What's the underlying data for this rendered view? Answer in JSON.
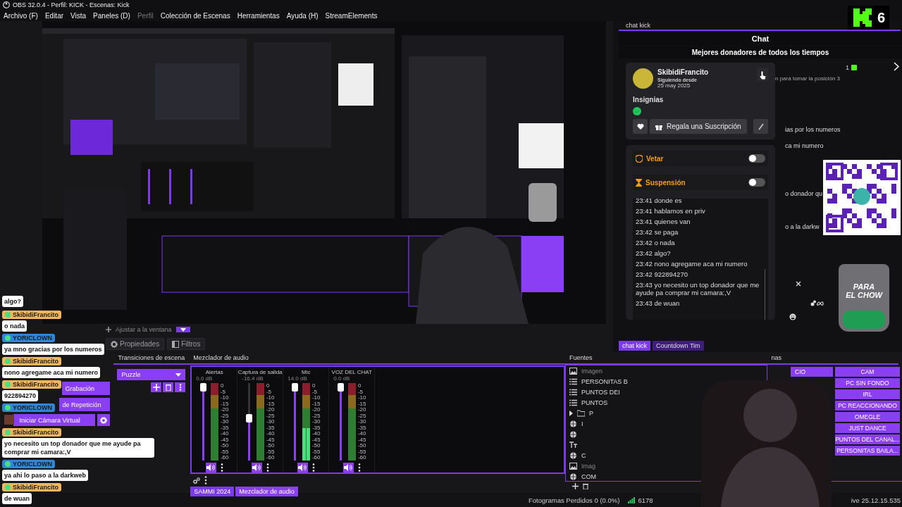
{
  "window": {
    "title": "OBS 32.0.4 - Perfil: KICK - Escenas: Kick"
  },
  "menu": [
    {
      "label": "Archivo (F)",
      "disabled": false
    },
    {
      "label": "Editar",
      "disabled": false
    },
    {
      "label": "Vista",
      "disabled": false
    },
    {
      "label": "Paneles (D)",
      "disabled": false
    },
    {
      "label": "Perfil",
      "disabled": true
    },
    {
      "label": "Colección de Escenas",
      "disabled": false
    },
    {
      "label": "Herramientas",
      "disabled": false
    },
    {
      "label": "Ayuda (H)",
      "disabled": false
    },
    {
      "label": "StreamElements",
      "disabled": false
    }
  ],
  "stream_logo": {
    "count": "6"
  },
  "preview_toolbar": {
    "fit_label": "Ajustar a la ventana"
  },
  "source_buttons": [
    {
      "label": "Propiedades",
      "kind": "properties"
    },
    {
      "label": "Filtros",
      "kind": "filters"
    }
  ],
  "chat_dock": {
    "tab": "chat kick",
    "header": "Chat",
    "subheader": "Mejores donadores de todos los tiempos",
    "user_card": {
      "username": "SkibidiFrancito",
      "following_label": "Siguiendo desde",
      "following_date": "25 may 2025",
      "badges_label": "Insignias",
      "gift_button": "Regala una Suscripción"
    },
    "moderation": [
      {
        "label": "Vetar",
        "kind": "ban",
        "on": false
      },
      {
        "label": "Suspensión",
        "kind": "timeout",
        "on": false
      }
    ],
    "log": [
      "23:41 donde es",
      "23:41 hablamos en priv",
      "23:41 quienes van",
      "23:42 se paga",
      "23:42 o nada",
      "23:42 algo?",
      "23:42 nono agregame aca mi numero",
      "23:42 922894270",
      "23:43 yo necesito un top donador que me ayude pa comprar mi camara:,V",
      "23:43 de wuan"
    ],
    "behind": {
      "rank": "1",
      "position_text": "n para tomar la posición 3",
      "fragments": [
        "ias por los numeros",
        "ca mi numero",
        "o donador qu",
        "o a la darkw"
      ]
    },
    "dock_tabs": [
      {
        "label": "chat kick",
        "selected": true
      },
      {
        "label": "Countdown Tim",
        "selected": false
      }
    ]
  },
  "jar_overlay": {
    "lines": [
      "PARA",
      "EL CHOW"
    ]
  },
  "chat_overlay": [
    {
      "kind": "message",
      "text": "algo?"
    },
    {
      "kind": "user",
      "name": "SkibidiFrancito",
      "color": "#f2b75c"
    },
    {
      "kind": "message",
      "text": "o nada"
    },
    {
      "kind": "user",
      "name": "YORICLOWN",
      "color": "#2f86d6"
    },
    {
      "kind": "message",
      "text": "ya mno gracias por los numeros"
    },
    {
      "kind": "user",
      "name": "SkibidiFrancito",
      "color": "#f2b75c"
    },
    {
      "kind": "message",
      "text": "nono agregame aca mi numero"
    },
    {
      "kind": "user",
      "name": "SkibidiFrancito",
      "color": "#f2b75c"
    },
    {
      "kind": "message",
      "text": "922894270"
    },
    {
      "kind": "user",
      "name": "YORICLOWN",
      "color": "#2f86d6"
    },
    {
      "kind": "emote"
    },
    {
      "kind": "user",
      "name": "SkibidiFrancito",
      "color": "#f2b75c"
    },
    {
      "kind": "message",
      "text": "yo necesito un top donador que me ayude pa comprar mi camara:,V"
    },
    {
      "kind": "user",
      "name": "YORICLOWN",
      "color": "#2f86d6"
    },
    {
      "kind": "message",
      "text": "ya ahi lo paso a la darkweb"
    },
    {
      "kind": "user",
      "name": "SkibidiFrancito",
      "color": "#f2b75c"
    },
    {
      "kind": "message",
      "text": "de wuan"
    }
  ],
  "controls": [
    {
      "label": "Grabación",
      "kind": "plain"
    },
    {
      "label": "de Repetición",
      "kind": "plain"
    },
    {
      "label": "Iniciar Cámara Virtual",
      "kind": "settings"
    }
  ],
  "transitions": {
    "title": "Transiciones de escena",
    "selected": "Puzzle"
  },
  "mixer": {
    "title": "Mezclador de audio",
    "channels": [
      {
        "name": "Alertas",
        "reading": "0.0 dB",
        "level": 1.0,
        "meter": {
          "level": 0
        },
        "scale": [
          "0",
          "-5",
          "-10",
          "-15",
          "-20",
          "-25",
          "-30",
          "-35",
          "-40",
          "-45",
          "-50",
          "-55",
          "-60"
        ]
      },
      {
        "name": "Captura de salida",
        "reading": "-16.4 dB",
        "level": 0.55,
        "meter": {
          "level": 0
        },
        "scale": [
          "0",
          "-5",
          "-10",
          "-15",
          "-20",
          "-25",
          "-30",
          "-35",
          "-40",
          "-45",
          "-50",
          "-55",
          "-60"
        ]
      },
      {
        "name": "Mic",
        "reading": "14.0 dB",
        "level": 1.0,
        "meter": {
          "level": 0.42
        },
        "scale": [
          "0",
          "-5",
          "-10",
          "-15",
          "-20",
          "-25",
          "-30",
          "-35",
          "-40",
          "-45",
          "-50",
          "-55",
          "-60"
        ]
      },
      {
        "name": "VOZ DEL CHAT",
        "reading": "0.0 dB",
        "level": 1.0,
        "meter": {
          "level": 0
        },
        "scale": [
          "0",
          "-5",
          "-10",
          "-15",
          "-20",
          "-25",
          "-30",
          "-35",
          "-40",
          "-45",
          "-50",
          "-55",
          "-60"
        ]
      }
    ],
    "tabs": [
      {
        "label": "SAMMI 2024",
        "selected": false
      },
      {
        "label": "Mezclador de audio",
        "selected": true
      }
    ]
  },
  "sources": {
    "title": "Fuentes",
    "items": [
      {
        "name": "Imagen",
        "kind": "image"
      },
      {
        "name": "PERSONITAS B",
        "kind": "group"
      },
      {
        "name": "PUNTOS DEI",
        "kind": "group"
      },
      {
        "name": "PUNTOS",
        "kind": "group"
      },
      {
        "name": "P",
        "kind": "folder"
      },
      {
        "name": "I",
        "kind": "browser"
      },
      {
        "kind": "browser"
      },
      {
        "kind": "text"
      },
      {
        "name": "C",
        "kind": "browser"
      },
      {
        "name": "Imag",
        "kind": "image"
      },
      {
        "name": "COM",
        "kind": "browser"
      }
    ]
  },
  "scenes": {
    "title": "nas",
    "left": [
      "CIO"
    ],
    "right": [
      "CAM",
      "PC SIN FONDO",
      "IRL",
      "PC REACCIONANDO",
      "OMEGLE",
      "JUST DANCE",
      "PUNTOS DEL CANAL...",
      "PERSONITAS BAILA..."
    ]
  },
  "status_bar": {
    "dropped": "Fotogramas Perdidos 0 (0.0%)",
    "bitrate": "6178",
    "time": "ive 25.12.15.535"
  }
}
